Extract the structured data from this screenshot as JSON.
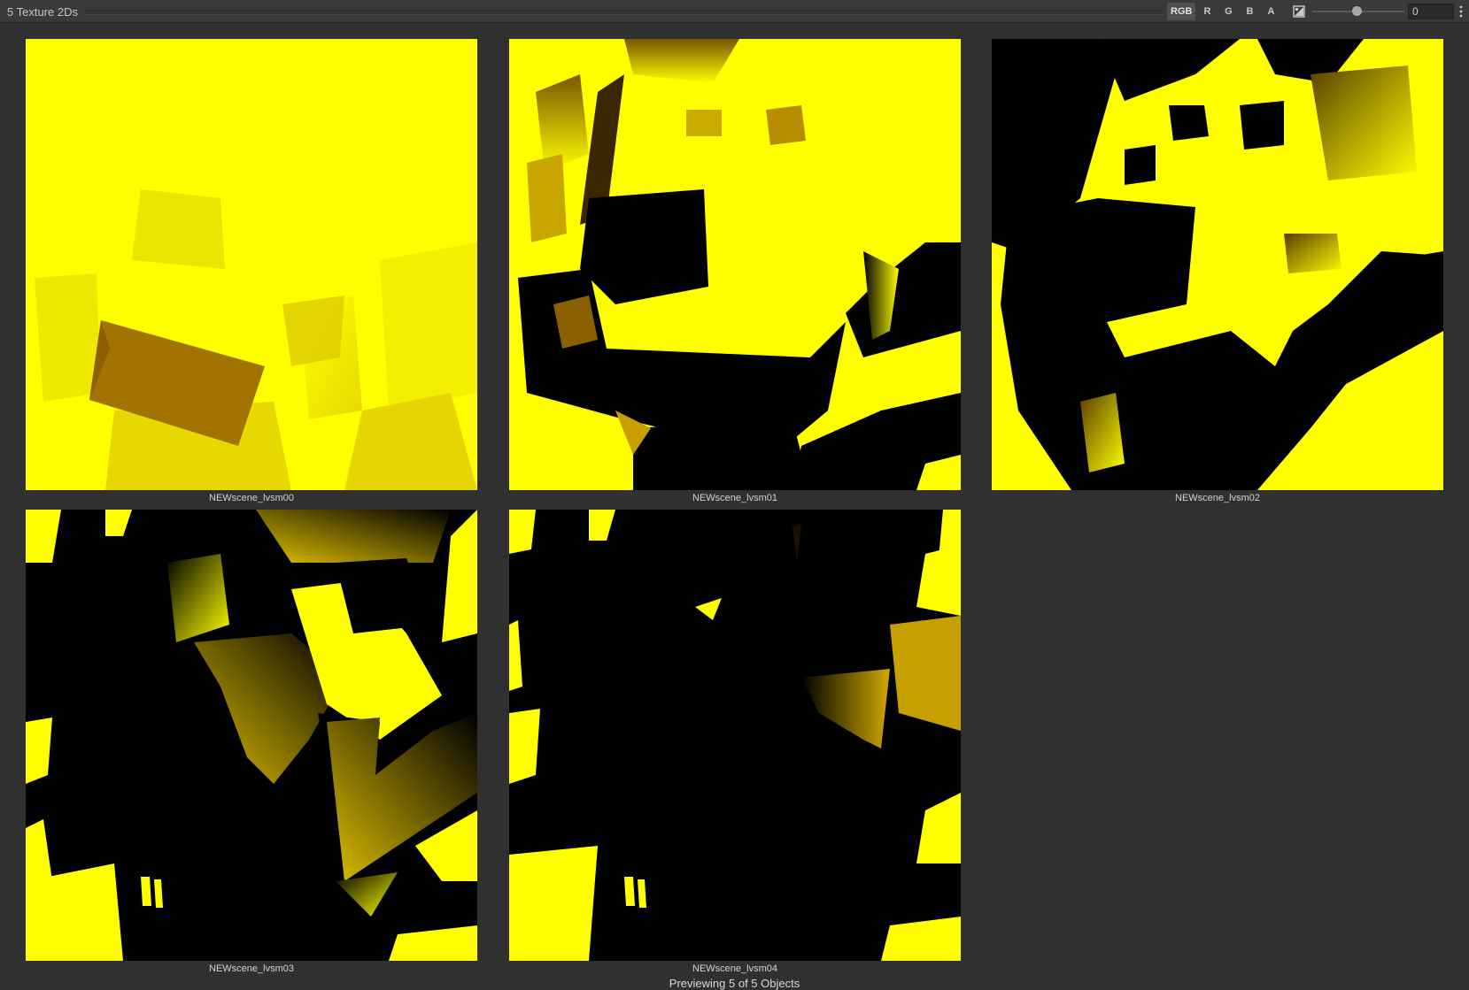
{
  "header": {
    "title": "5 Texture 2Ds",
    "channels": [
      "RGB",
      "R",
      "G",
      "B",
      "A"
    ],
    "active_channel": "RGB",
    "mip_value": "0",
    "alpha_toggle_icon": "alpha-visibility-icon",
    "menu_icon": "kebab-menu-icon"
  },
  "textures": [
    {
      "name": "NEWscene_lvsm00"
    },
    {
      "name": "NEWscene_lvsm01"
    },
    {
      "name": "NEWscene_lvsm02"
    },
    {
      "name": "NEWscene_lvsm03"
    },
    {
      "name": "NEWscene_lvsm04"
    }
  ],
  "footer": {
    "status": "Previewing 5 of 5 Objects"
  },
  "colors": {
    "background": "#303030",
    "toolbar": "#3a3a3a",
    "shadow_yellow": "#ffff00",
    "shadow_dark": "#000000"
  }
}
